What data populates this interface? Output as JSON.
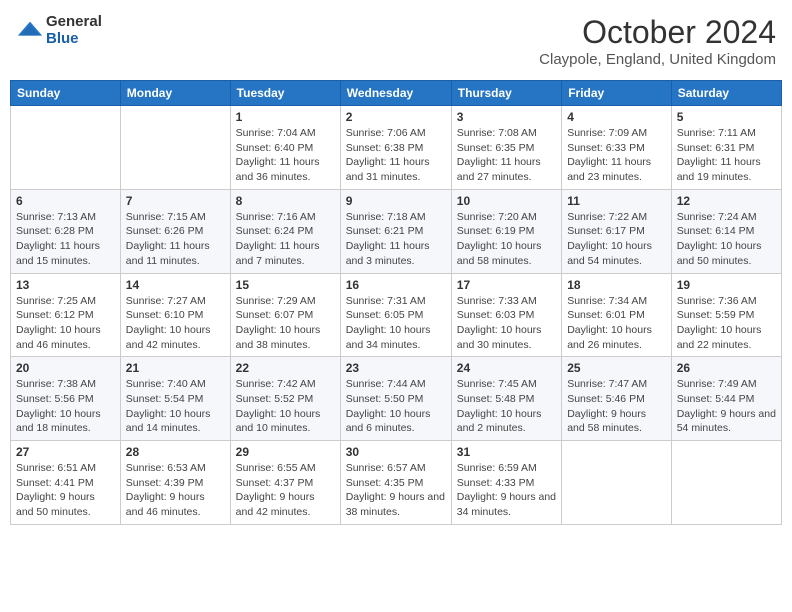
{
  "header": {
    "logo": {
      "general": "General",
      "blue": "Blue"
    },
    "title": "October 2024",
    "location": "Claypole, England, United Kingdom"
  },
  "weekdays": [
    "Sunday",
    "Monday",
    "Tuesday",
    "Wednesday",
    "Thursday",
    "Friday",
    "Saturday"
  ],
  "weeks": [
    [
      {
        "day": null,
        "info": ""
      },
      {
        "day": null,
        "info": ""
      },
      {
        "day": "1",
        "sunrise": "Sunrise: 7:04 AM",
        "sunset": "Sunset: 6:40 PM",
        "daylight": "Daylight: 11 hours and 36 minutes."
      },
      {
        "day": "2",
        "sunrise": "Sunrise: 7:06 AM",
        "sunset": "Sunset: 6:38 PM",
        "daylight": "Daylight: 11 hours and 31 minutes."
      },
      {
        "day": "3",
        "sunrise": "Sunrise: 7:08 AM",
        "sunset": "Sunset: 6:35 PM",
        "daylight": "Daylight: 11 hours and 27 minutes."
      },
      {
        "day": "4",
        "sunrise": "Sunrise: 7:09 AM",
        "sunset": "Sunset: 6:33 PM",
        "daylight": "Daylight: 11 hours and 23 minutes."
      },
      {
        "day": "5",
        "sunrise": "Sunrise: 7:11 AM",
        "sunset": "Sunset: 6:31 PM",
        "daylight": "Daylight: 11 hours and 19 minutes."
      }
    ],
    [
      {
        "day": "6",
        "sunrise": "Sunrise: 7:13 AM",
        "sunset": "Sunset: 6:28 PM",
        "daylight": "Daylight: 11 hours and 15 minutes."
      },
      {
        "day": "7",
        "sunrise": "Sunrise: 7:15 AM",
        "sunset": "Sunset: 6:26 PM",
        "daylight": "Daylight: 11 hours and 11 minutes."
      },
      {
        "day": "8",
        "sunrise": "Sunrise: 7:16 AM",
        "sunset": "Sunset: 6:24 PM",
        "daylight": "Daylight: 11 hours and 7 minutes."
      },
      {
        "day": "9",
        "sunrise": "Sunrise: 7:18 AM",
        "sunset": "Sunset: 6:21 PM",
        "daylight": "Daylight: 11 hours and 3 minutes."
      },
      {
        "day": "10",
        "sunrise": "Sunrise: 7:20 AM",
        "sunset": "Sunset: 6:19 PM",
        "daylight": "Daylight: 10 hours and 58 minutes."
      },
      {
        "day": "11",
        "sunrise": "Sunrise: 7:22 AM",
        "sunset": "Sunset: 6:17 PM",
        "daylight": "Daylight: 10 hours and 54 minutes."
      },
      {
        "day": "12",
        "sunrise": "Sunrise: 7:24 AM",
        "sunset": "Sunset: 6:14 PM",
        "daylight": "Daylight: 10 hours and 50 minutes."
      }
    ],
    [
      {
        "day": "13",
        "sunrise": "Sunrise: 7:25 AM",
        "sunset": "Sunset: 6:12 PM",
        "daylight": "Daylight: 10 hours and 46 minutes."
      },
      {
        "day": "14",
        "sunrise": "Sunrise: 7:27 AM",
        "sunset": "Sunset: 6:10 PM",
        "daylight": "Daylight: 10 hours and 42 minutes."
      },
      {
        "day": "15",
        "sunrise": "Sunrise: 7:29 AM",
        "sunset": "Sunset: 6:07 PM",
        "daylight": "Daylight: 10 hours and 38 minutes."
      },
      {
        "day": "16",
        "sunrise": "Sunrise: 7:31 AM",
        "sunset": "Sunset: 6:05 PM",
        "daylight": "Daylight: 10 hours and 34 minutes."
      },
      {
        "day": "17",
        "sunrise": "Sunrise: 7:33 AM",
        "sunset": "Sunset: 6:03 PM",
        "daylight": "Daylight: 10 hours and 30 minutes."
      },
      {
        "day": "18",
        "sunrise": "Sunrise: 7:34 AM",
        "sunset": "Sunset: 6:01 PM",
        "daylight": "Daylight: 10 hours and 26 minutes."
      },
      {
        "day": "19",
        "sunrise": "Sunrise: 7:36 AM",
        "sunset": "Sunset: 5:59 PM",
        "daylight": "Daylight: 10 hours and 22 minutes."
      }
    ],
    [
      {
        "day": "20",
        "sunrise": "Sunrise: 7:38 AM",
        "sunset": "Sunset: 5:56 PM",
        "daylight": "Daylight: 10 hours and 18 minutes."
      },
      {
        "day": "21",
        "sunrise": "Sunrise: 7:40 AM",
        "sunset": "Sunset: 5:54 PM",
        "daylight": "Daylight: 10 hours and 14 minutes."
      },
      {
        "day": "22",
        "sunrise": "Sunrise: 7:42 AM",
        "sunset": "Sunset: 5:52 PM",
        "daylight": "Daylight: 10 hours and 10 minutes."
      },
      {
        "day": "23",
        "sunrise": "Sunrise: 7:44 AM",
        "sunset": "Sunset: 5:50 PM",
        "daylight": "Daylight: 10 hours and 6 minutes."
      },
      {
        "day": "24",
        "sunrise": "Sunrise: 7:45 AM",
        "sunset": "Sunset: 5:48 PM",
        "daylight": "Daylight: 10 hours and 2 minutes."
      },
      {
        "day": "25",
        "sunrise": "Sunrise: 7:47 AM",
        "sunset": "Sunset: 5:46 PM",
        "daylight": "Daylight: 9 hours and 58 minutes."
      },
      {
        "day": "26",
        "sunrise": "Sunrise: 7:49 AM",
        "sunset": "Sunset: 5:44 PM",
        "daylight": "Daylight: 9 hours and 54 minutes."
      }
    ],
    [
      {
        "day": "27",
        "sunrise": "Sunrise: 6:51 AM",
        "sunset": "Sunset: 4:41 PM",
        "daylight": "Daylight: 9 hours and 50 minutes."
      },
      {
        "day": "28",
        "sunrise": "Sunrise: 6:53 AM",
        "sunset": "Sunset: 4:39 PM",
        "daylight": "Daylight: 9 hours and 46 minutes."
      },
      {
        "day": "29",
        "sunrise": "Sunrise: 6:55 AM",
        "sunset": "Sunset: 4:37 PM",
        "daylight": "Daylight: 9 hours and 42 minutes."
      },
      {
        "day": "30",
        "sunrise": "Sunrise: 6:57 AM",
        "sunset": "Sunset: 4:35 PM",
        "daylight": "Daylight: 9 hours and 38 minutes."
      },
      {
        "day": "31",
        "sunrise": "Sunrise: 6:59 AM",
        "sunset": "Sunset: 4:33 PM",
        "daylight": "Daylight: 9 hours and 34 minutes."
      },
      {
        "day": null,
        "info": ""
      },
      {
        "day": null,
        "info": ""
      }
    ]
  ]
}
